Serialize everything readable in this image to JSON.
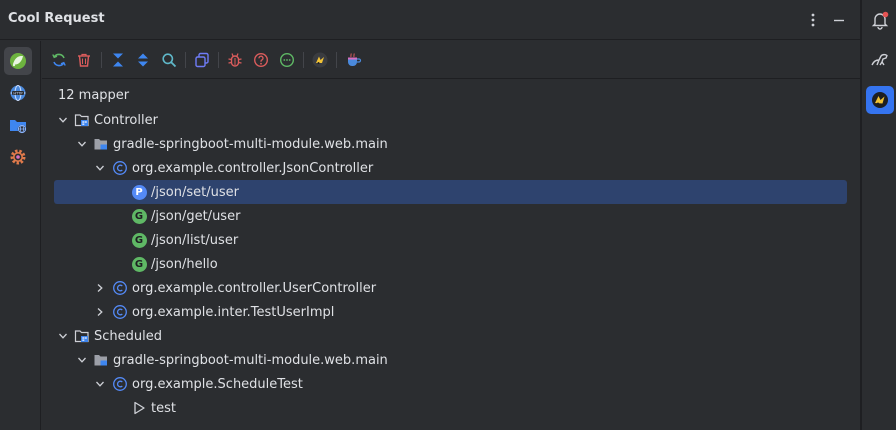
{
  "header": {
    "title": "Cool Request",
    "more_icon": "vertical-ellipsis-icon",
    "minimize_icon": "minimize-icon"
  },
  "leftbar": {
    "items": [
      {
        "name": "spring-icon",
        "active": true
      },
      {
        "name": "http-globe-icon",
        "active": false
      },
      {
        "name": "folder-web-icon",
        "active": false
      },
      {
        "name": "settings-gear-icon",
        "active": false
      }
    ]
  },
  "toolbar": {
    "items": [
      "refresh-icon",
      "delete-icon",
      "collapse-all-icon",
      "expand-all-icon",
      "search-icon",
      "copy-icon",
      "bug-icon",
      "help-icon",
      "comment-icon",
      "sponsor-icon",
      "coffee-icon"
    ]
  },
  "tree": {
    "summary": "12 mapper",
    "controller_group": "Controller",
    "controller_module": "gradle-springboot-multi-module.web.main",
    "json_controller": "org.example.controller.JsonController",
    "endpoints": [
      {
        "method": "P",
        "path": "/json/set/user",
        "selected": true
      },
      {
        "method": "G",
        "path": "/json/get/user",
        "selected": false
      },
      {
        "method": "G",
        "path": "/json/list/user",
        "selected": false
      },
      {
        "method": "G",
        "path": "/json/hello",
        "selected": false
      }
    ],
    "user_controller": "org.example.controller.UserController",
    "test_user_impl": "org.example.inter.TestUserImpl",
    "scheduled_group": "Scheduled",
    "scheduled_module": "gradle-springboot-multi-module.web.main",
    "schedule_test": "org.example.ScheduleTest",
    "schedule_method": "test"
  },
  "rightbar": {
    "items": [
      {
        "name": "notifications-icon",
        "active": false
      },
      {
        "name": "dino-icon",
        "active": false
      },
      {
        "name": "cool-request-icon",
        "active": true
      }
    ]
  },
  "colors": {
    "background": "#2b2d30",
    "selection": "#2e436e",
    "accent": "#3574f0",
    "post_badge": "#548af7",
    "get_badge": "#5fb865"
  }
}
